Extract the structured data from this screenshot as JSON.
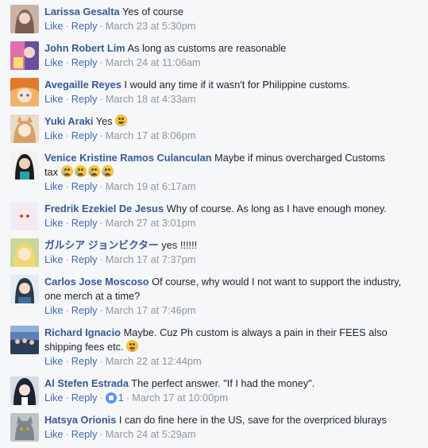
{
  "labels": {
    "like": "Like",
    "reply": "Reply",
    "dot": "·"
  },
  "comments": [
    {
      "name": "Larissa Gesalta",
      "text": "Yes of course",
      "time": "March 23 at 5:30pm"
    },
    {
      "name": "John Robert Lim",
      "text": "As long as customs are reasonable",
      "time": "March 24 at 11:06am"
    },
    {
      "name": "Avegaille Reyes",
      "text": "I would any time if it wasn't for Philippine customs.",
      "time": "March 18 at 4:33am"
    },
    {
      "name": "Yuki Araki",
      "text": "Yes",
      "time": "March 17 at 8:06pm",
      "emoji": "smile"
    },
    {
      "name": "Venice Kristine Ramos Culanculan",
      "text": "Maybe if minus overcharged Customs",
      "text2": "tax",
      "time": "March 19 at 6:17am",
      "emoji": "cry x4"
    },
    {
      "name": "Fredrik Ezekiel De Jesus",
      "text": "Why of course. As long as I have enough money.",
      "time": "March 27 at 3:01pm"
    },
    {
      "name": "ガルシア ジョンビクター",
      "text": "yes !!!!!!",
      "time": "March 17 at 7:37pm"
    },
    {
      "name": "Carlos Jose Moscoso",
      "text": "Of course, why would I not want to support the industry,",
      "text2": "one merch at a time?",
      "time": "March 17 at 7:46pm"
    },
    {
      "name": "Richard Ignacio",
      "text": "Maybe. Cuz Ph custom is always a pain in their FEES also",
      "text2": "shipping fees etc.",
      "time": "March 22 at 12:44pm",
      "emoji": "tongue"
    },
    {
      "name": "Al Stefen Estrada",
      "text": "The perfect answer. \"If I had the money\".",
      "time": "March 17 at 10:00pm",
      "like_count": "1"
    },
    {
      "name": "Hatsya Orionis",
      "text": "I can do fine here in the US, save for the overpriced blurays",
      "time": "March 24 at 5:29am"
    }
  ],
  "colors": {
    "name": "#365899",
    "link": "#4267b2",
    "meta": "#90949c",
    "background": "#f6f7f9"
  }
}
